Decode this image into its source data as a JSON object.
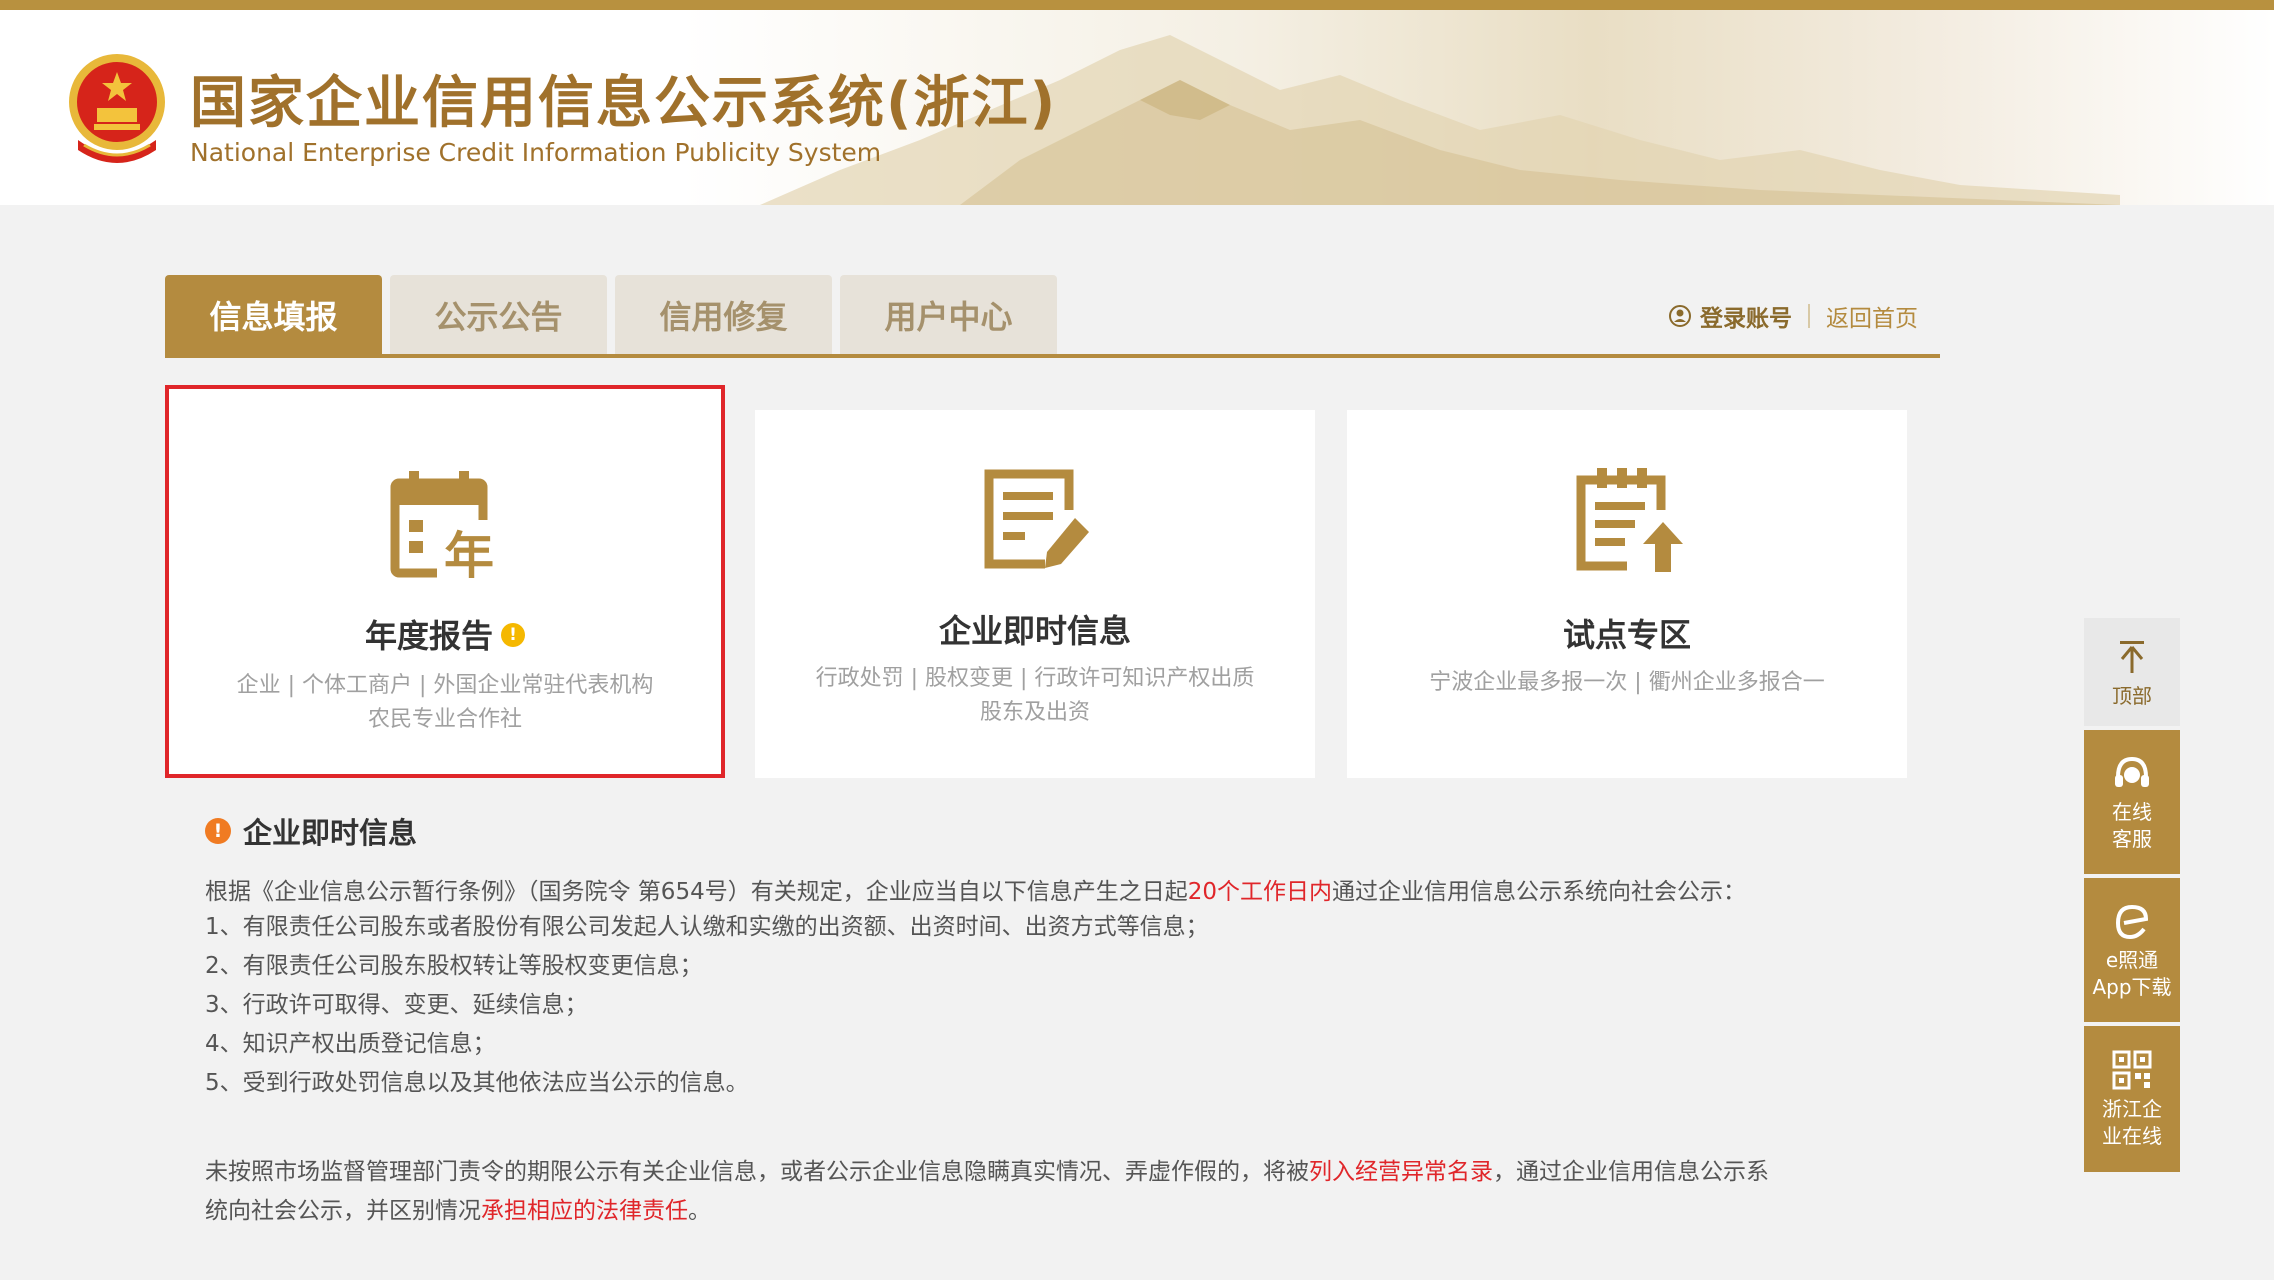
{
  "header": {
    "title": "国家企业信用信息公示系统(浙江)",
    "subtitle": "National Enterprise Credit Information Publicity System"
  },
  "tabs": [
    {
      "label": "信息填报",
      "active": true
    },
    {
      "label": "公示公告",
      "active": false
    },
    {
      "label": "信用修复",
      "active": false
    },
    {
      "label": "用户中心",
      "active": false
    }
  ],
  "user_links": {
    "login": "登录账号",
    "home": "返回首页"
  },
  "cards": [
    {
      "title": "年度报告",
      "icon": "calendar-year-icon",
      "desc_line1": "企业 | 个体工商户 | 外国企业常驻代表机构",
      "desc_line2": "农民专业合作社",
      "badge": "!"
    },
    {
      "title": "企业即时信息",
      "icon": "document-edit-icon",
      "desc_line1": "行政处罚 | 股权变更 | 行政许可知识产权出质",
      "desc_line2": "股东及出资"
    },
    {
      "title": "试点专区",
      "icon": "clipboard-upload-icon",
      "desc_line1": "宁波企业最多报一次 | 衢州企业多报合一"
    }
  ],
  "notice": {
    "heading": "企业即时信息",
    "intro_before": "根据《企业信息公示暂行条例》（国务院令 第654号）有关规定，企业应当自以下信息产生之日起",
    "intro_highlight": "20个工作日内",
    "intro_after": "通过企业信用信息公示系统向社会公示：",
    "items": [
      "1、有限责任公司股东或者股份有限公司发起人认缴和实缴的出资额、出资时间、出资方式等信息；",
      "2、有限责任公司股东股权转让等股权变更信息；",
      "3、行政许可取得、变更、延续信息；",
      "4、知识产权出质登记信息；",
      "5、受到行政处罚信息以及其他依法应当公示的信息。"
    ],
    "footer_before": "未按照市场监督管理部门责令的期限公示有关企业信息，或者公示企业信息隐瞒真实情况、弄虚作假的，将被",
    "footer_highlight1": "列入经营异常名录",
    "footer_mid": "，通过企业信用信息公示系",
    "footer_line2_before": "统向社会公示，并区别情况",
    "footer_highlight2": "承担相应的法律责任",
    "footer_end": "。"
  },
  "sidebar": {
    "top": "顶部",
    "service_line1": "在线",
    "service_line2": "客服",
    "app_line1": "e照通",
    "app_line2": "App下载",
    "online_line1": "浙江企",
    "online_line2": "业在线"
  },
  "colors": {
    "brand_gold": "#b48b3f",
    "highlight_red": "#e0262a",
    "selection_border": "#e0262a"
  }
}
